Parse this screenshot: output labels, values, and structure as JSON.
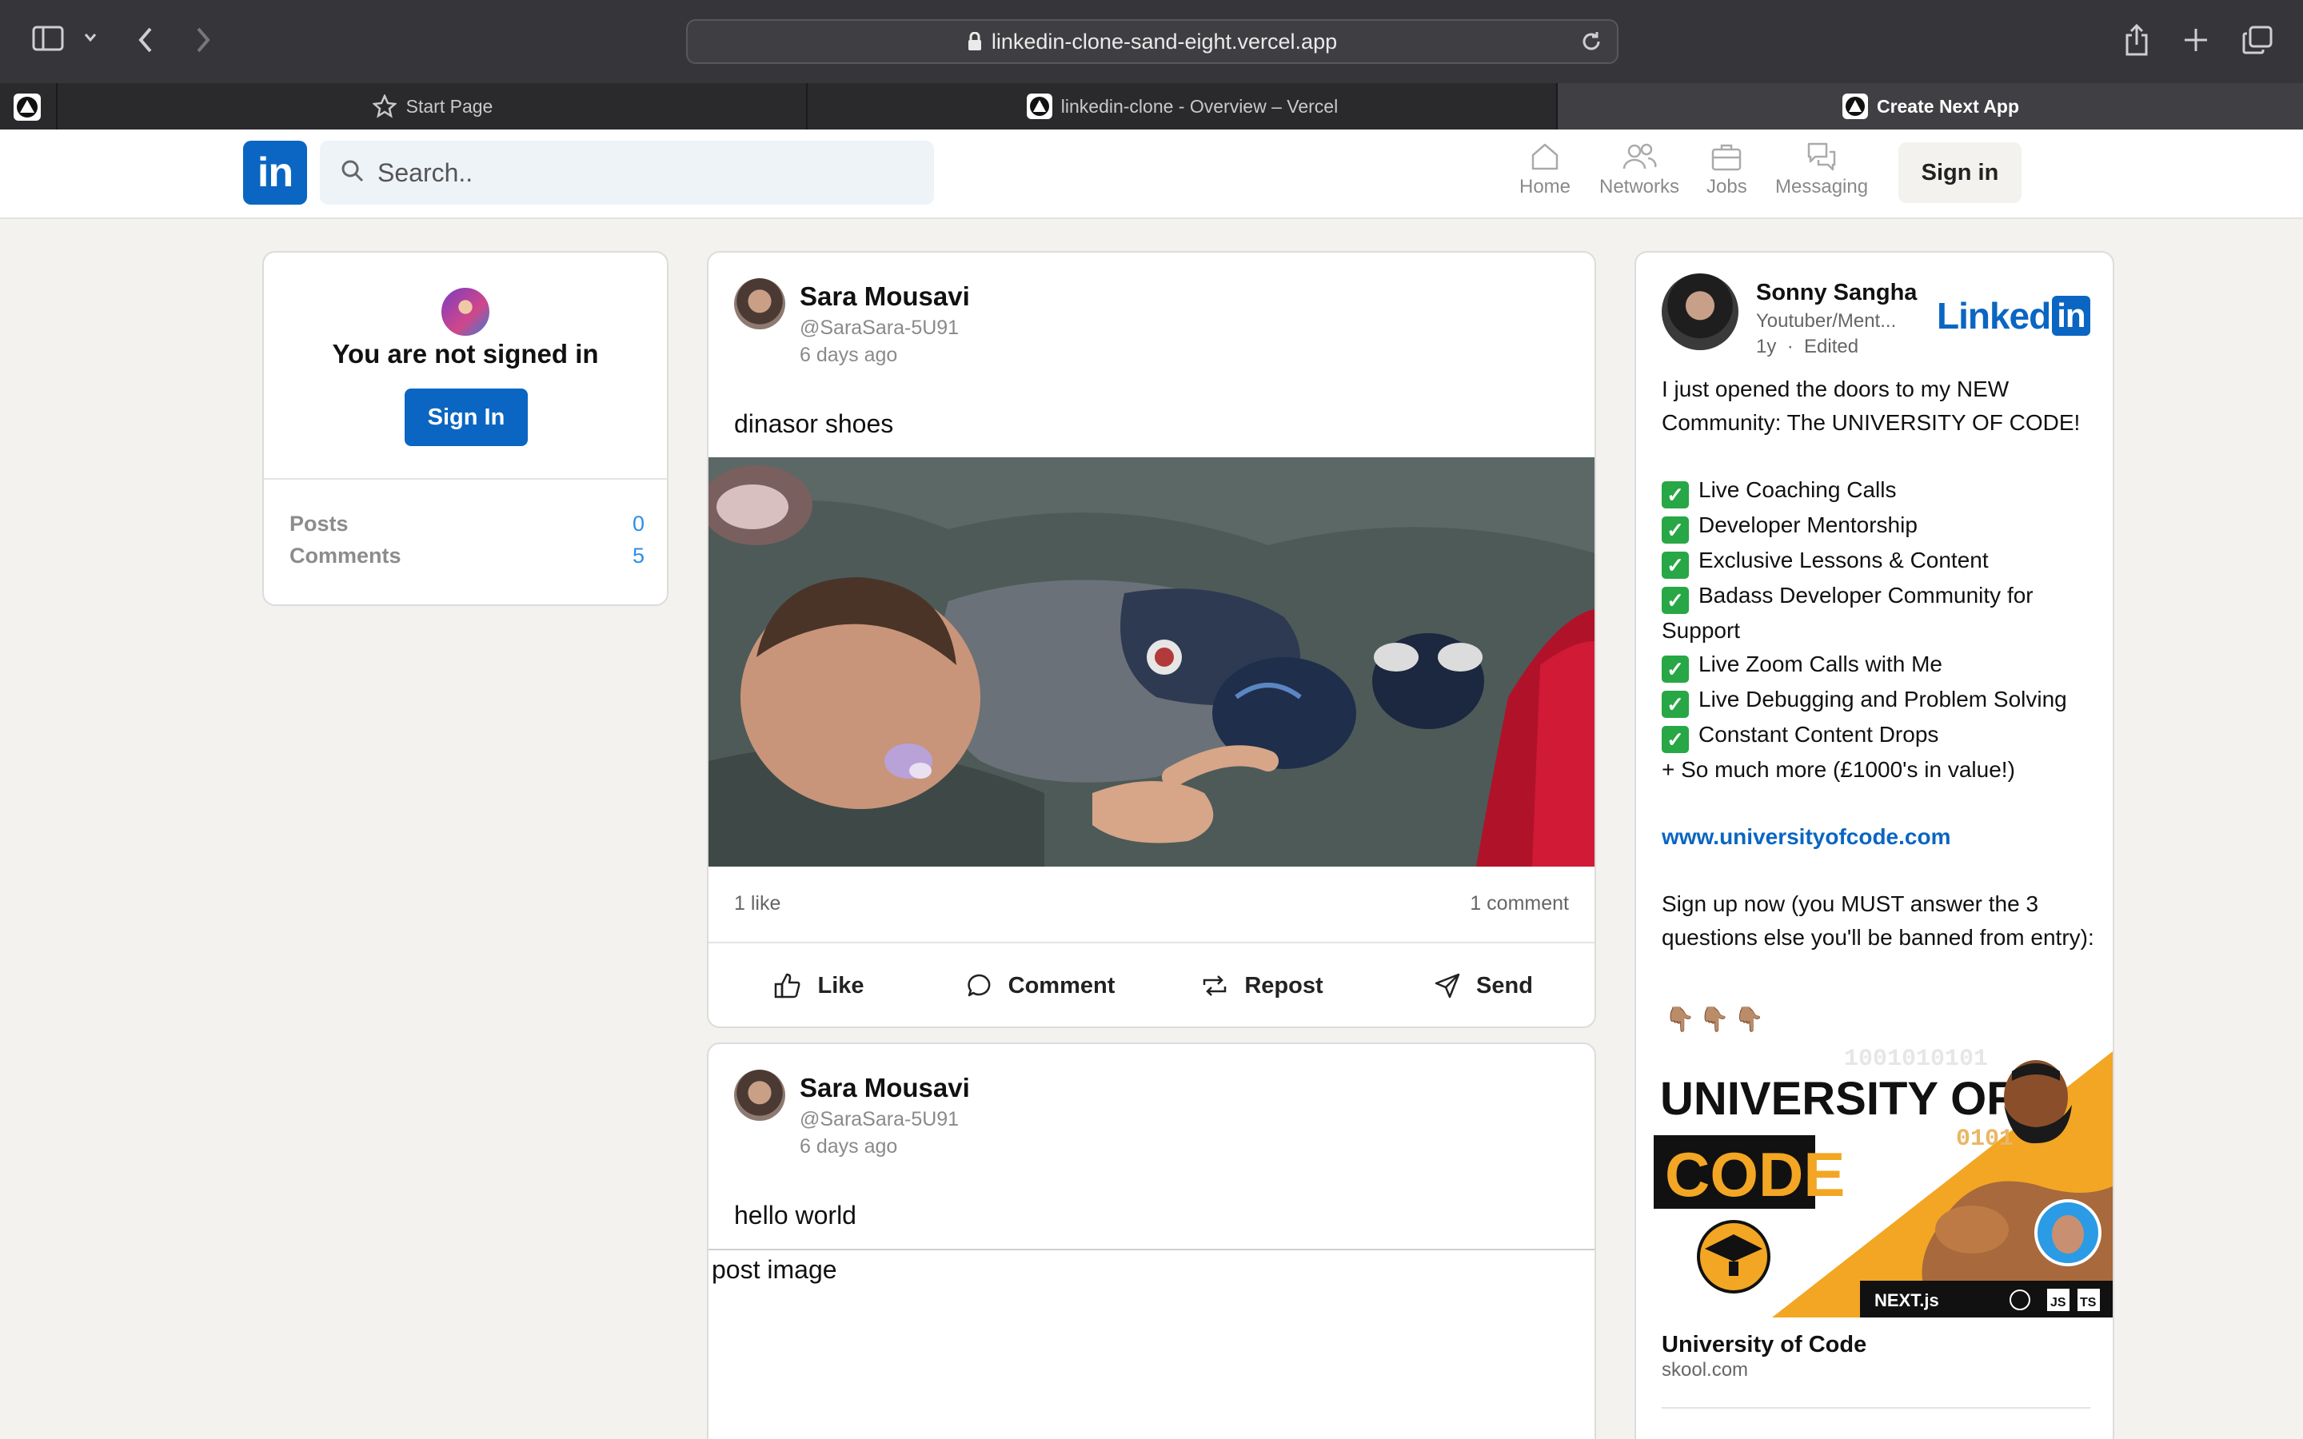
{
  "browser": {
    "url": "linkedin-clone-sand-eight.vercel.app",
    "tabs": [
      {
        "label": "Start Page"
      },
      {
        "label": "linkedin-clone - Overview – Vercel"
      },
      {
        "label": "Create Next App"
      }
    ]
  },
  "header": {
    "logo": "in",
    "search_placeholder": "Search..",
    "nav": [
      {
        "label": "Home",
        "icon": "home-icon"
      },
      {
        "label": "Networks",
        "icon": "networks-icon"
      },
      {
        "label": "Jobs",
        "icon": "jobs-icon"
      },
      {
        "label": "Messaging",
        "icon": "messaging-icon"
      }
    ],
    "signin_label": "Sign in"
  },
  "profile_card": {
    "status": "You are not signed in",
    "button": "Sign In",
    "stats": [
      {
        "label": "Posts",
        "value": "0"
      },
      {
        "label": "Comments",
        "value": "5"
      }
    ]
  },
  "posts": [
    {
      "author": "Sara Mousavi",
      "handle": "@SaraSara-5U91",
      "time": "6 days ago",
      "text": "dinasor shoes",
      "likes": "1 like",
      "comments": "1 comment"
    },
    {
      "author": "Sara Mousavi",
      "handle": "@SaraSara-5U91",
      "time": "6 days ago",
      "text": "hello world",
      "image_alt": "post image"
    }
  ],
  "actions": {
    "like": "Like",
    "comment": "Comment",
    "repost": "Repost",
    "send": "Send"
  },
  "promo": {
    "name": "Sonny Sangha",
    "role": "Youtuber/Ment...",
    "age": "1y",
    "edited": "Edited",
    "logo_text": "Linked",
    "logo_box": "in",
    "intro": "I just opened the doors to my NEW Community: The UNIVERSITY OF CODE!",
    "checks": [
      "Live Coaching Calls",
      "Developer Mentorship",
      "Exclusive Lessons & Content",
      "Badass Developer Community for Support",
      "Live Zoom Calls with Me",
      "Live Debugging and Problem Solving",
      "Constant Content Drops"
    ],
    "extra": "+ So much more (£1000's in value!)",
    "link": "www.universityofcode.com",
    "cta": "Sign up now (you MUST answer the 3 questions else you'll be banned from entry):",
    "hands": "👇🏽👇🏽👇🏽",
    "banner_title_1": "UNIVERSITY OF",
    "banner_title_2": "CODE",
    "banner_tech": "NEXT.js",
    "banner_js": "JS",
    "banner_ts": "TS",
    "card_title": "University of Code",
    "card_domain": "skool.com"
  },
  "colors": {
    "brand": "#0a66c2",
    "page_bg": "#f3f2ef",
    "browser_bg": "#36363a",
    "stat_value": "#2c8fe6"
  }
}
